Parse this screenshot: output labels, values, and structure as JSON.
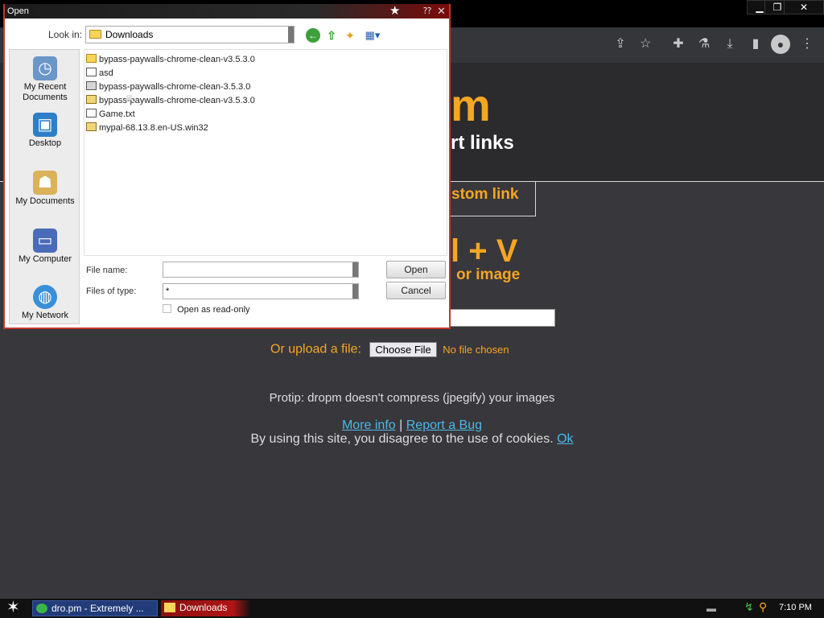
{
  "browser": {
    "window_controls": {
      "minimize": "▁",
      "maximize": "❐",
      "close": "✕"
    },
    "toolbar_icons": [
      "share-icon",
      "star-icon",
      "extensions-icon",
      "flask-icon",
      "download-icon",
      "sidepanel-icon",
      "profile-icon",
      "menu-icon"
    ]
  },
  "page": {
    "logo_fragment": "m",
    "tagline_fragment": "rt links",
    "custom_link_fragment": "stom link",
    "paste_hint_fragment": "l + V",
    "paste_sub_fragment": "or image",
    "upload_label": "Or upload a file:",
    "choose_file_label": "Choose File",
    "no_file_text": "No file chosen",
    "protip": "Protip: dropm doesn't compress (jpegify) your images",
    "more_info_link": "More info",
    "separator": "|",
    "report_bug_link": "Report a Bug",
    "cookies_text": "By using this site, you disagree to the use of cookies.",
    "ok_link": "Ok",
    "colors": {
      "accent": "#f5a623",
      "link": "#4db8e8",
      "background": "#38373b"
    }
  },
  "dialog": {
    "title": "Open",
    "look_in_label": "Look in:",
    "look_in_value": "Downloads",
    "places": [
      {
        "label": "My Recent Documents",
        "icon": "recent-documents-icon"
      },
      {
        "label": "Desktop",
        "icon": "desktop-icon"
      },
      {
        "label": "My Documents",
        "icon": "my-documents-icon"
      },
      {
        "label": "My Computer",
        "icon": "my-computer-icon"
      },
      {
        "label": "My Network",
        "icon": "my-network-icon"
      }
    ],
    "files": [
      {
        "name": "bypass-paywalls-chrome-clean-v3.5.3.0",
        "type": "folder"
      },
      {
        "name": "asd",
        "type": "text"
      },
      {
        "name": "bypass-paywalls-chrome-clean-3.5.3.0",
        "type": "exe"
      },
      {
        "name": "bypass-paywalls-chrome-clean-v3.5.3.0",
        "type": "zip"
      },
      {
        "name": "Game.txt",
        "type": "text"
      },
      {
        "name": "mypal-68.13.8.en-US.win32",
        "type": "zip"
      }
    ],
    "file_name_label": "File name:",
    "file_name_value": "",
    "files_of_type_label": "Files of type:",
    "files_of_type_value": "*",
    "read_only_label": "Open as read-only",
    "open_button": "Open",
    "cancel_button": "Cancel"
  },
  "taskbar": {
    "tasks": [
      {
        "label": "dro.pm - Extremely ...",
        "icon": "browser-icon"
      },
      {
        "label": "Downloads",
        "icon": "folder-icon"
      }
    ],
    "clock": "7:10 PM"
  }
}
